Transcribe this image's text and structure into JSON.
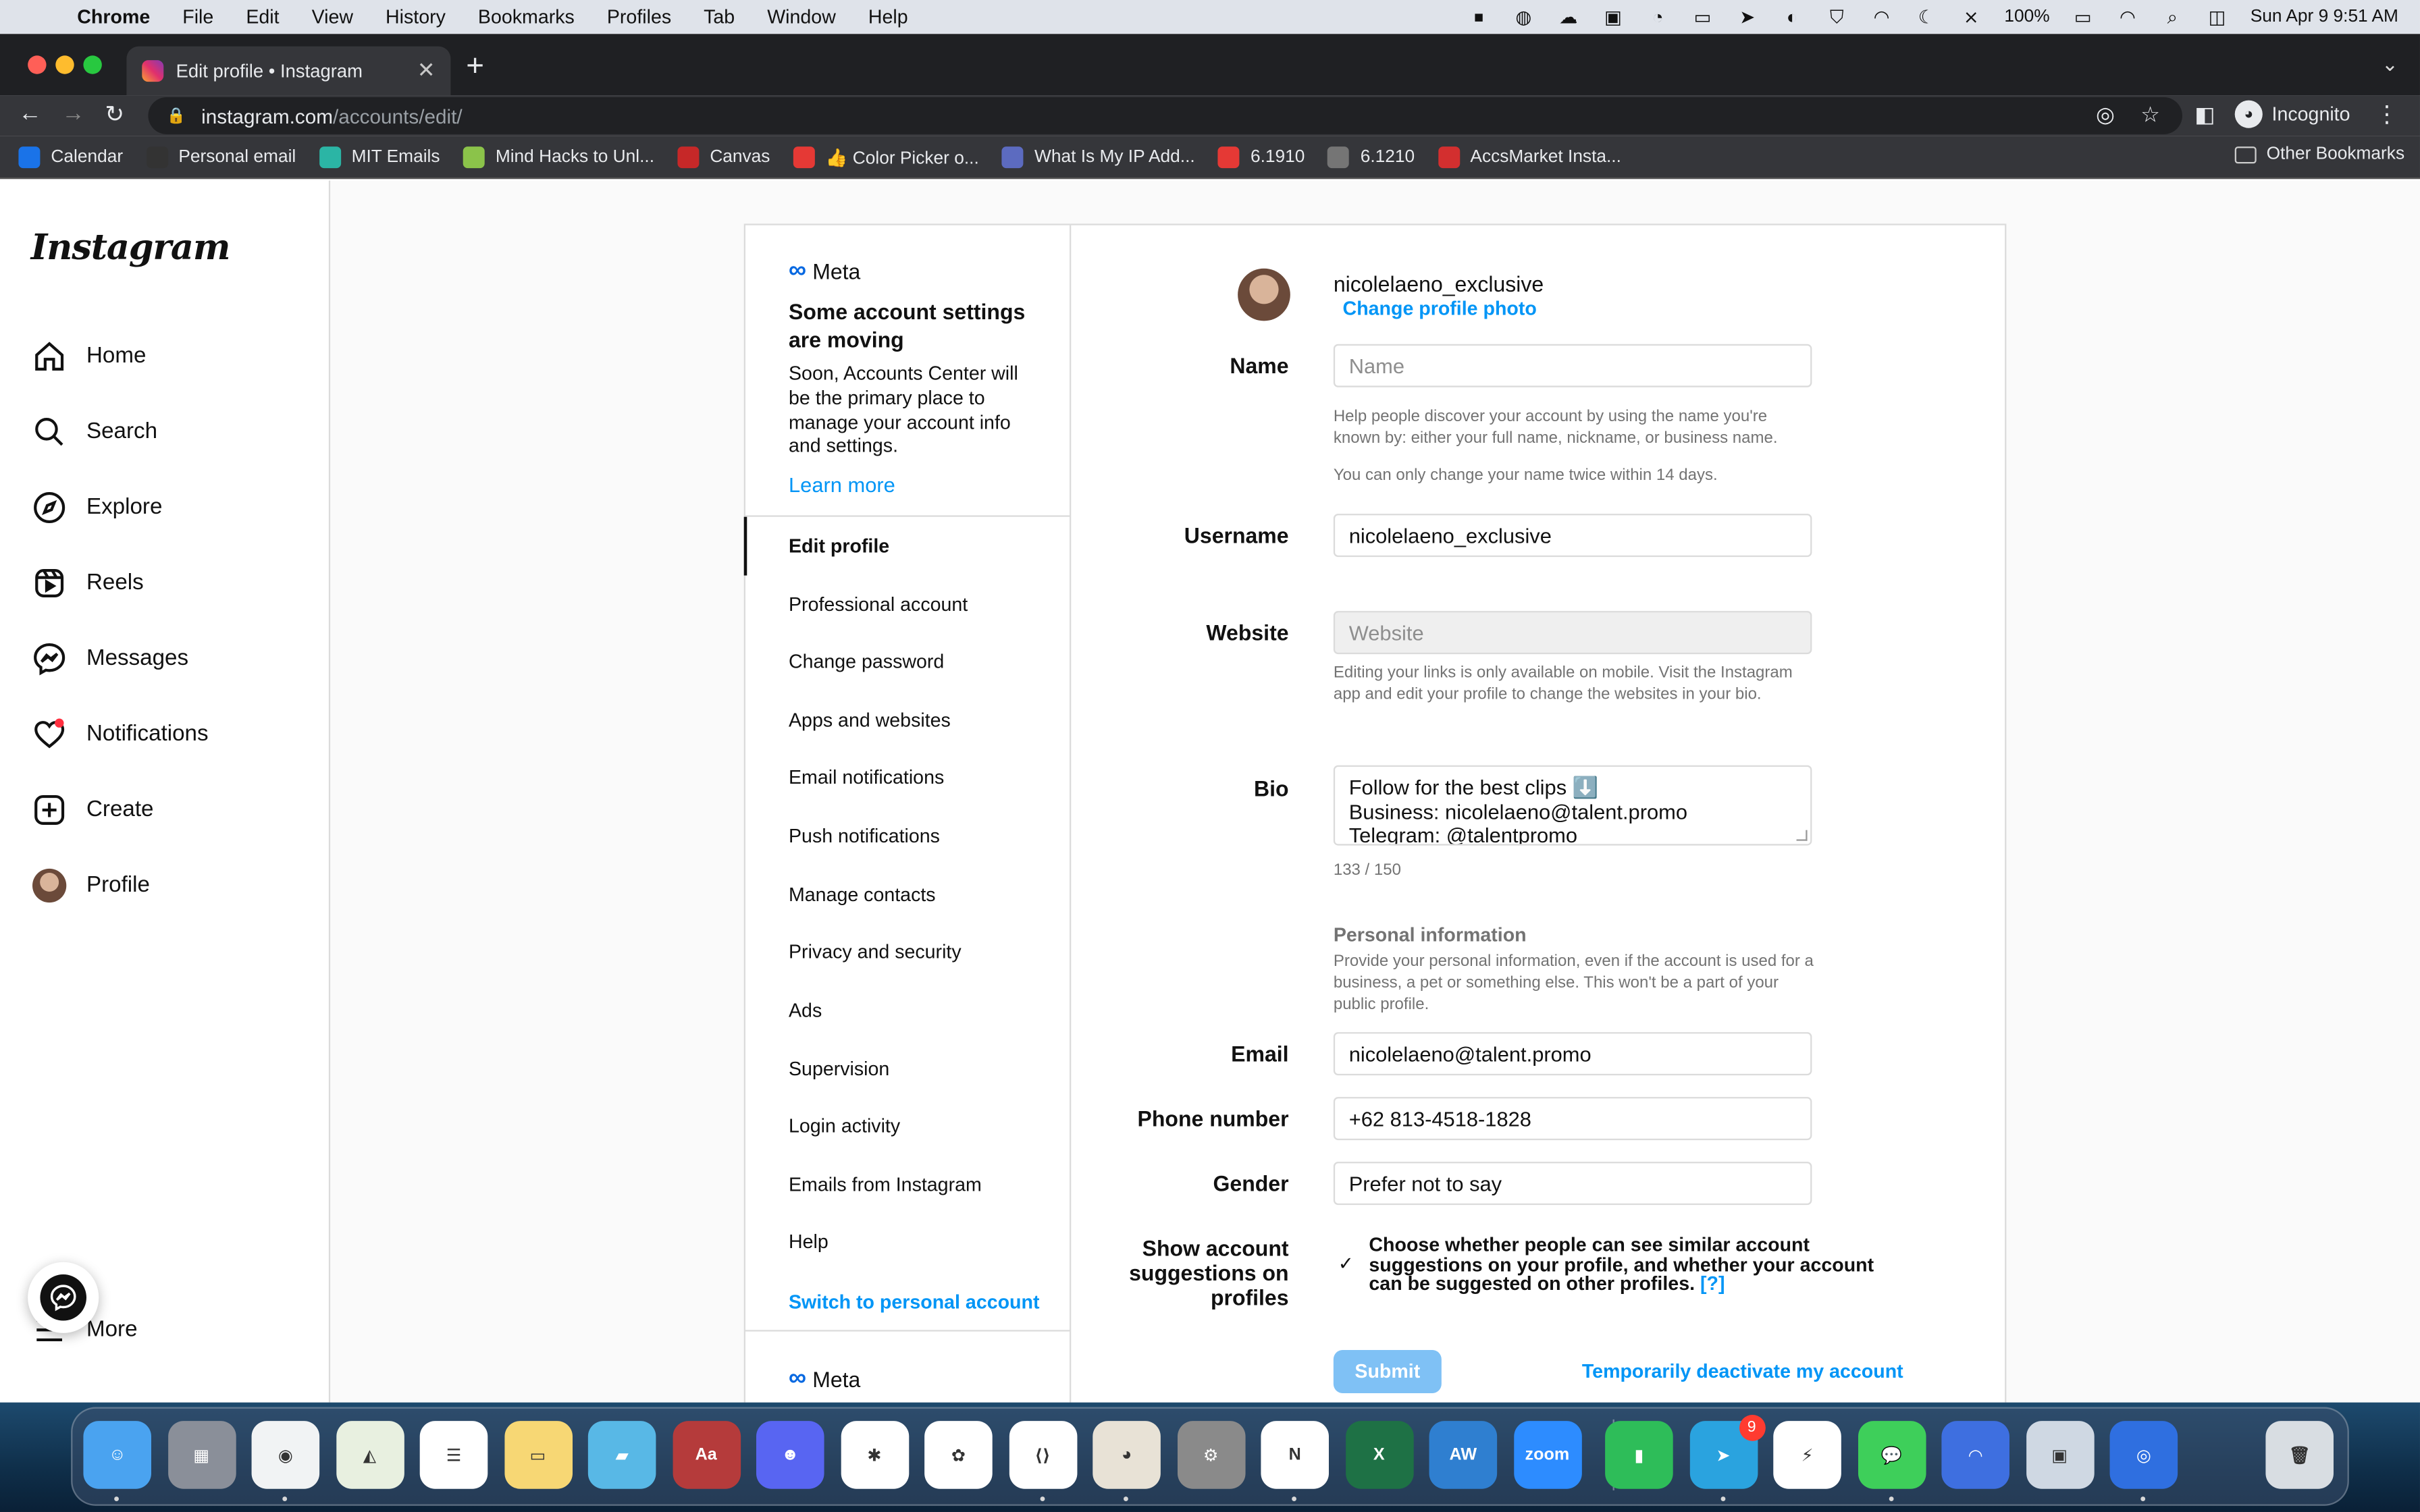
{
  "menubar": {
    "app": "Chrome",
    "items": [
      "File",
      "Edit",
      "View",
      "History",
      "Bookmarks",
      "Profiles",
      "Tab",
      "Window",
      "Help"
    ],
    "battery": "100%",
    "datetime": "Sun Apr 9  9:51 AM"
  },
  "browser": {
    "tab_title": "Edit profile • Instagram",
    "url_host": "instagram.com",
    "url_path": "/accounts/edit/",
    "profile_label": "Incognito",
    "bookmarks": [
      {
        "label": "Calendar",
        "color": "#1a73e8",
        "icon": "calendar-icon"
      },
      {
        "label": "Personal email",
        "color": "#333333",
        "icon": "mail-icon"
      },
      {
        "label": "MIT Emails",
        "color": "#2bb5a5",
        "icon": "mail-icon"
      },
      {
        "label": "Mind Hacks to Unl...",
        "color": "#8bc34a",
        "icon": "play-icon"
      },
      {
        "label": "Canvas",
        "color": "#c62828",
        "icon": "canvas-icon"
      },
      {
        "label": "👍 Color Picker o...",
        "color": "#e53935",
        "icon": "picker-icon"
      },
      {
        "label": "What Is My IP Add...",
        "color": "#5c6bc0",
        "icon": "globe-icon"
      },
      {
        "label": "6.1910",
        "color": "#e53935",
        "icon": "course-icon"
      },
      {
        "label": "6.1210",
        "color": "#757575",
        "icon": "globe-icon"
      },
      {
        "label": "AccsMarket Insta...",
        "color": "#d32f2f",
        "icon": "a-icon"
      }
    ],
    "other_bookmarks": "Other Bookmarks"
  },
  "sidebar": {
    "logo": "Instagram",
    "items": [
      {
        "label": "Home",
        "icon": "home-icon"
      },
      {
        "label": "Search",
        "icon": "search-icon"
      },
      {
        "label": "Explore",
        "icon": "compass-icon"
      },
      {
        "label": "Reels",
        "icon": "reels-icon"
      },
      {
        "label": "Messages",
        "icon": "messenger-icon"
      },
      {
        "label": "Notifications",
        "icon": "heart-icon"
      },
      {
        "label": "Create",
        "icon": "plus-square-icon"
      },
      {
        "label": "Profile",
        "icon": "avatar-icon"
      }
    ],
    "more": "More"
  },
  "settings_menu": {
    "meta_label": "Meta",
    "moving_title": "Some account settings are moving",
    "moving_text": "Soon, Accounts Center will be the primary place to manage your account info and settings.",
    "learn_more": "Learn more",
    "items": [
      "Edit profile",
      "Professional account",
      "Change password",
      "Apps and websites",
      "Email notifications",
      "Push notifications",
      "Manage contacts",
      "Privacy and security",
      "Ads",
      "Supervision",
      "Login activity",
      "Emails from Instagram",
      "Help"
    ],
    "switch": "Switch to personal account"
  },
  "form": {
    "username_display": "nicolelaeno_exclusive",
    "change_photo": "Change profile photo",
    "name_label": "Name",
    "name_placeholder": "Name",
    "name_help1": "Help people discover your account by using the name you're known by: either your full name, nickname, or business name.",
    "name_help2": "You can only change your name twice within 14 days.",
    "username_label": "Username",
    "username_value": "nicolelaeno_exclusive",
    "website_label": "Website",
    "website_placeholder": "Website",
    "website_help": "Editing your links is only available on mobile. Visit the Instagram app and edit your profile to change the websites in your bio.",
    "bio_label": "Bio",
    "bio_lines": [
      "Follow for the best clips ⬇️",
      "Business: nicolelaeno@talent.promo",
      "Telegram: @talentpromo"
    ],
    "bio_counter": "133 / 150",
    "personal_title": "Personal information",
    "personal_help": "Provide your personal information, even if the account is used for a business, a pet or something else. This won't be a part of your public profile.",
    "email_label": "Email",
    "email_value": "nicolelaeno@talent.promo",
    "phone_label": "Phone number",
    "phone_value": "+62 813-4518-1828",
    "gender_label": "Gender",
    "gender_value": "Prefer not to say",
    "suggestions_label": "Show account suggestions on profiles",
    "suggestions_text": "Choose whether people can see similar account suggestions on your profile, and whether your account can be suggested on other profiles.",
    "suggestions_help": "[?]",
    "suggestions_checked": true,
    "submit": "Submit",
    "deactivate": "Temporarily deactivate my account"
  },
  "dock": {
    "apps": [
      {
        "name": "finder",
        "color": "#4aa3f0",
        "glyph": "☺"
      },
      {
        "name": "launchpad",
        "color": "#8a8f99",
        "glyph": "▦"
      },
      {
        "name": "chrome",
        "color": "#f1f3f4",
        "glyph": "◉"
      },
      {
        "name": "maps",
        "color": "#e8f0e0",
        "glyph": "◭"
      },
      {
        "name": "reminders",
        "color": "#ffffff",
        "glyph": "☰"
      },
      {
        "name": "notes",
        "color": "#f7d774",
        "glyph": "▭"
      },
      {
        "name": "stickies",
        "color": "#58b8e6",
        "glyph": "▰"
      },
      {
        "name": "dictionary",
        "color": "#b53b3b",
        "glyph": "Aa"
      },
      {
        "name": "discord",
        "color": "#5865f2",
        "glyph": "☻"
      },
      {
        "name": "slack",
        "color": "#ffffff",
        "glyph": "✱"
      },
      {
        "name": "photos",
        "color": "#ffffff",
        "glyph": "✿"
      },
      {
        "name": "vscode",
        "color": "#ffffff",
        "glyph": "⟨⟩"
      },
      {
        "name": "cyberduck",
        "color": "#e8e2d6",
        "glyph": "◕"
      },
      {
        "name": "system-preferences",
        "color": "#8a8a8a",
        "glyph": "⚙"
      },
      {
        "name": "notion",
        "color": "#ffffff",
        "glyph": "N"
      },
      {
        "name": "excel",
        "color": "#1e7145",
        "glyph": "X"
      },
      {
        "name": "aw-reader",
        "color": "#2f7fd0",
        "glyph": "AW"
      },
      {
        "name": "zoom",
        "color": "#2d8cff",
        "glyph": "zoom"
      },
      {
        "name": "numbers",
        "color": "#2ebd59",
        "glyph": "▮"
      },
      {
        "name": "telegram",
        "color": "#2aa3df",
        "glyph": "➤",
        "badge": "9"
      },
      {
        "name": "messenger",
        "color": "#ffffff",
        "glyph": "⚡"
      },
      {
        "name": "messages",
        "color": "#3ecf5a",
        "glyph": "💬"
      },
      {
        "name": "nordvpn",
        "color": "#3e6fe0",
        "glyph": "◠"
      },
      {
        "name": "preview",
        "color": "#cfd8e3",
        "glyph": "▣"
      },
      {
        "name": "screen-time",
        "color": "#2f6fe0",
        "glyph": "◎"
      },
      {
        "name": "trash",
        "color": "#d8dde2",
        "glyph": "🗑"
      }
    ]
  }
}
